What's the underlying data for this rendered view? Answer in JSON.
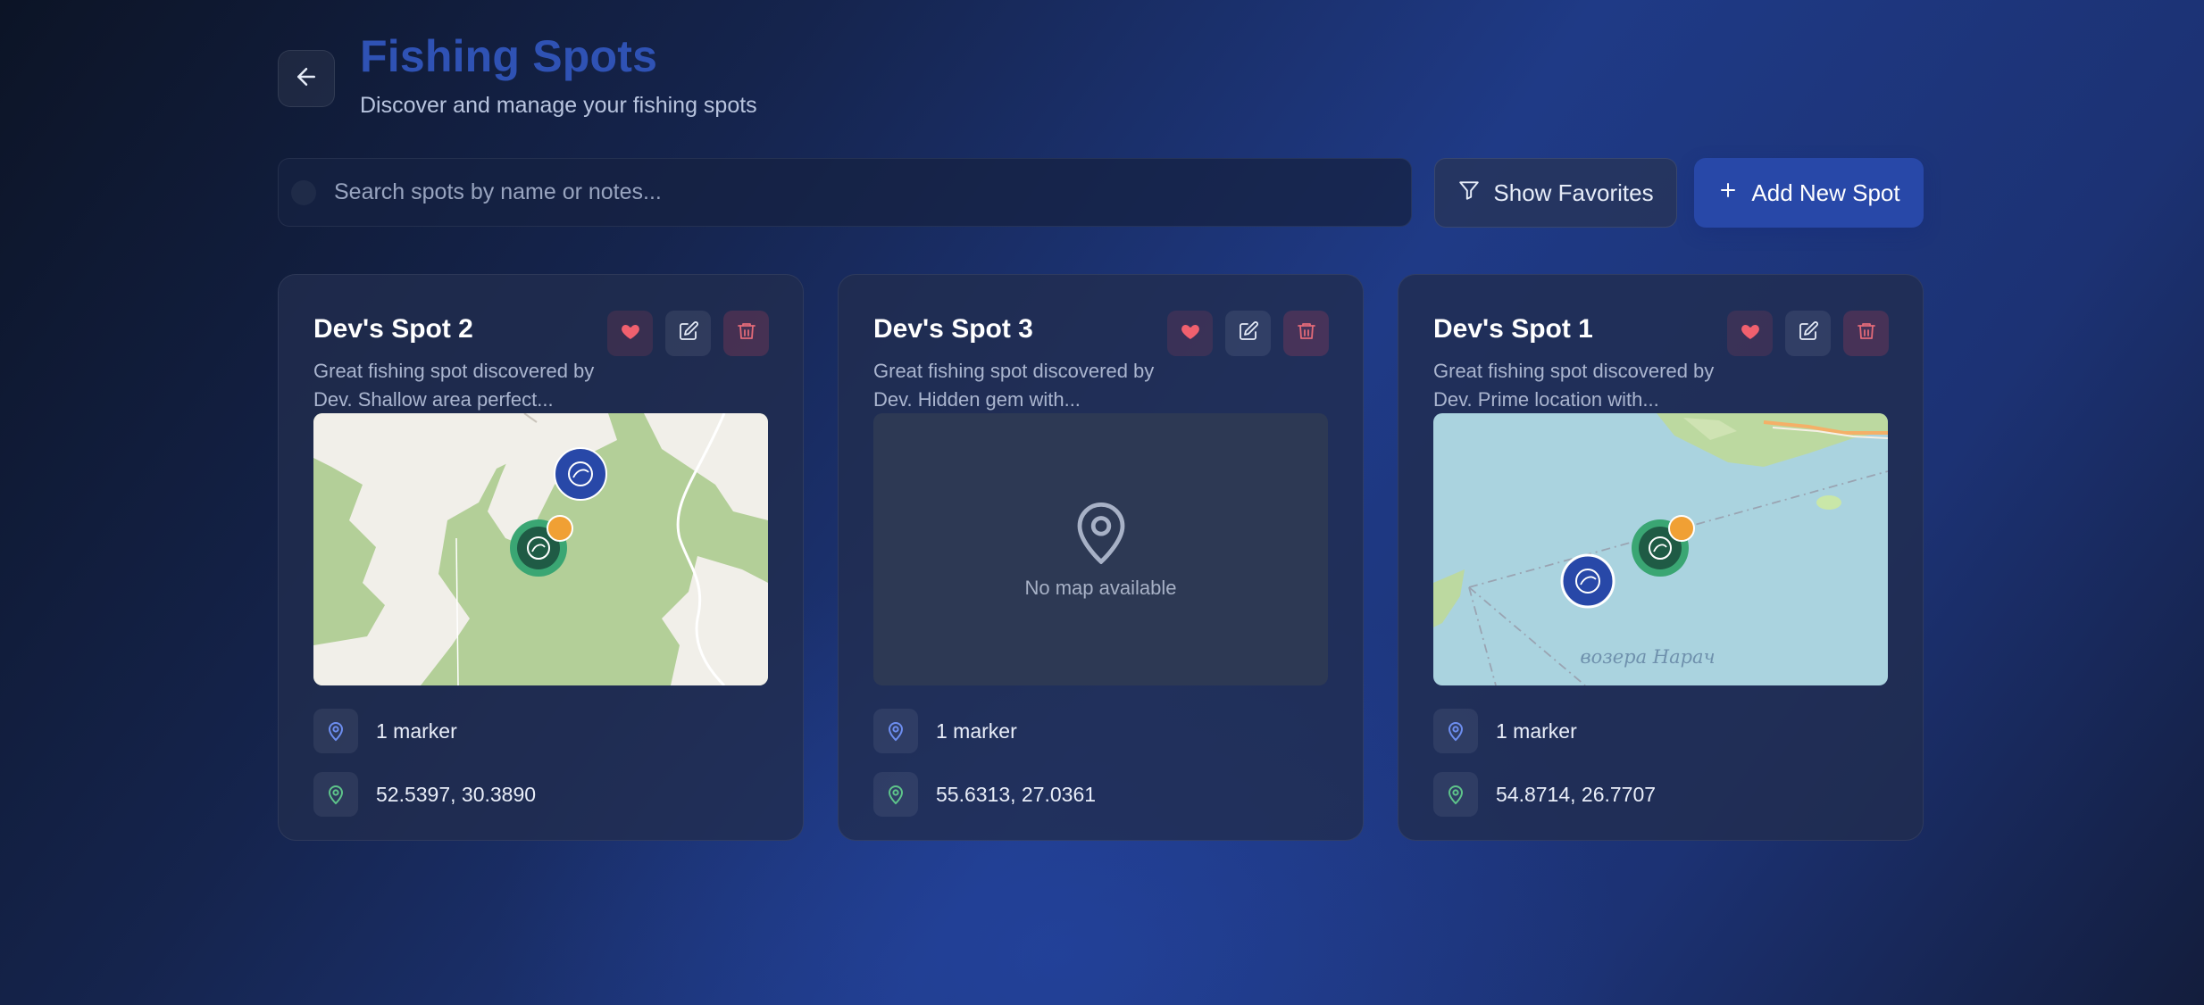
{
  "header": {
    "title": "Fishing Spots",
    "subtitle": "Discover and manage your fishing spots"
  },
  "search": {
    "placeholder": "Search spots by name or notes...",
    "value": ""
  },
  "toolbar": {
    "favorites_label": "Show Favorites",
    "add_label": "Add New Spot"
  },
  "colors": {
    "title": "#2f52b4",
    "primary_button": "#2848a8",
    "favorite": "#f0606e",
    "delete": "#e26a78",
    "marker_icon": "#6d8ef0",
    "coords_icon": "#5ec48a"
  },
  "spots": [
    {
      "name": "Dev's Spot 2",
      "description": "Great fishing spot discovered by Dev. Shallow area perfect...",
      "markers": "1 marker",
      "coordinates": "52.5397, 30.3890",
      "map": "forest"
    },
    {
      "name": "Dev's Spot 3",
      "description": "Great fishing spot discovered by Dev. Hidden gem with...",
      "markers": "1 marker",
      "coordinates": "55.6313, 27.0361",
      "map": "none",
      "no_map_text": "No map available"
    },
    {
      "name": "Dev's Spot 1",
      "description": "Great fishing spot discovered by Dev. Prime location with...",
      "markers": "1 marker",
      "coordinates": "54.8714, 26.7707",
      "map": "lake",
      "map_label": "возера Нарач"
    }
  ]
}
